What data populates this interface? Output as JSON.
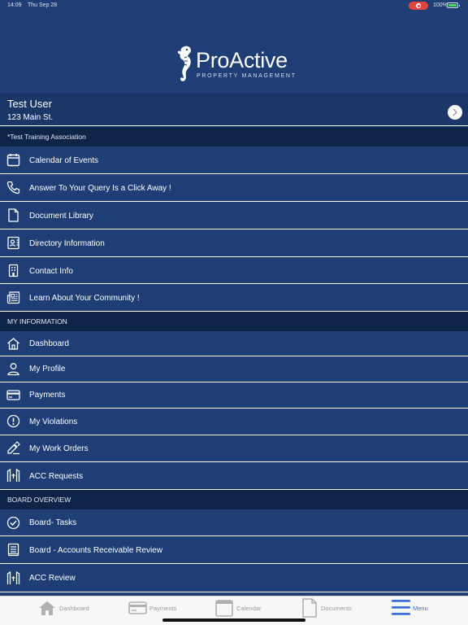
{
  "status_bar": {
    "time": "14:09",
    "date": "Thu Sep 28",
    "battery": "100%"
  },
  "logo": {
    "title": "ProActive",
    "subtitle": "PROPERTY MANAGEMENT"
  },
  "user": {
    "name": "Test User",
    "address": "123 Main St."
  },
  "association": "*Test Training Association",
  "community_items": [
    {
      "label": "Calendar of Events",
      "icon": "calendar-icon"
    },
    {
      "label": "Answer To Your Query Is a Click Away !",
      "icon": "phone-icon"
    },
    {
      "label": "Document Library",
      "icon": "document-icon"
    },
    {
      "label": "Directory Information",
      "icon": "contact-card-icon"
    },
    {
      "label": "Contact Info",
      "icon": "building-icon"
    },
    {
      "label": "Learn About Your Community !",
      "icon": "newspaper-icon"
    }
  ],
  "my_information": {
    "title": "MY INFORMATION",
    "items": [
      {
        "label": "Dashboard",
        "icon": "home-icon"
      },
      {
        "label": "My Profile",
        "icon": "person-icon"
      },
      {
        "label": "Payments",
        "icon": "credit-card-icon"
      },
      {
        "label": "My Violations",
        "icon": "exclamation-circle-icon"
      },
      {
        "label": "My Work Orders",
        "icon": "tools-icon"
      },
      {
        "label": "ACC Requests",
        "icon": "acc-icon"
      }
    ]
  },
  "board_overview": {
    "title": "BOARD OVERVIEW",
    "items": [
      {
        "label": "Board- Tasks",
        "icon": "check-circle-icon"
      },
      {
        "label": "Board - Accounts Receivable Review",
        "icon": "ledger-icon"
      },
      {
        "label": "ACC Review",
        "icon": "acc-icon"
      }
    ]
  },
  "tabs": [
    {
      "label": "Dashboard",
      "icon": "home-icon"
    },
    {
      "label": "Payments",
      "icon": "credit-card-icon"
    },
    {
      "label": "Calendar",
      "icon": "calendar-icon"
    },
    {
      "label": "Documents",
      "icon": "document-icon"
    },
    {
      "label": "Menu",
      "icon": "hamburger-menu-icon",
      "active": true
    }
  ],
  "colors": {
    "background": "#1e3e75",
    "section_header": "#0e2448",
    "active_tab": "#3a6fd8",
    "inactive_tab": "#9a9a9a"
  }
}
